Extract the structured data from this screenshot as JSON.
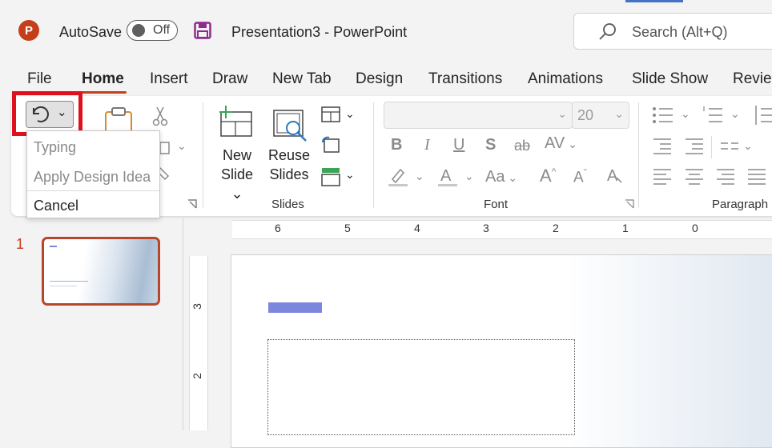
{
  "app": {
    "logo_letter": "P",
    "autosave_label": "AutoSave",
    "autosave_state": "Off",
    "document_title": "Presentation3  -  PowerPoint",
    "search_placeholder": "Search (Alt+Q)"
  },
  "tabs": [
    "File",
    "Home",
    "Insert",
    "Draw",
    "New Tab",
    "Design",
    "Transitions",
    "Animations",
    "Slide Show",
    "Revie"
  ],
  "active_tab": "Home",
  "undo_menu": {
    "items": [
      "Typing",
      "Apply Design Idea"
    ],
    "cancel": "Cancel"
  },
  "ribbon": {
    "slides_group": {
      "label": "Slides",
      "new_slide_line1": "New",
      "new_slide_line2": "Slide",
      "reuse_line1": "Reuse",
      "reuse_line2": "Slides"
    },
    "font_group": {
      "label": "Font",
      "font_size": "20",
      "bold": "B",
      "italic": "I",
      "underline": "U",
      "shadow": "S",
      "strike": "ab",
      "spacing": "AV",
      "case": "Aa",
      "grow": "A",
      "shrink": "A"
    },
    "paragraph_group": {
      "label": "Paragraph"
    }
  },
  "slides_pane": {
    "slide_number": "1"
  },
  "ruler": {
    "horizontal": [
      "6",
      "5",
      "4",
      "3",
      "2",
      "1",
      "0"
    ],
    "vertical": [
      "3",
      "2"
    ]
  },
  "colors": {
    "accent": "#c43e1c",
    "highlight": "#e0111e",
    "title_placeholder": "#7b86de"
  }
}
